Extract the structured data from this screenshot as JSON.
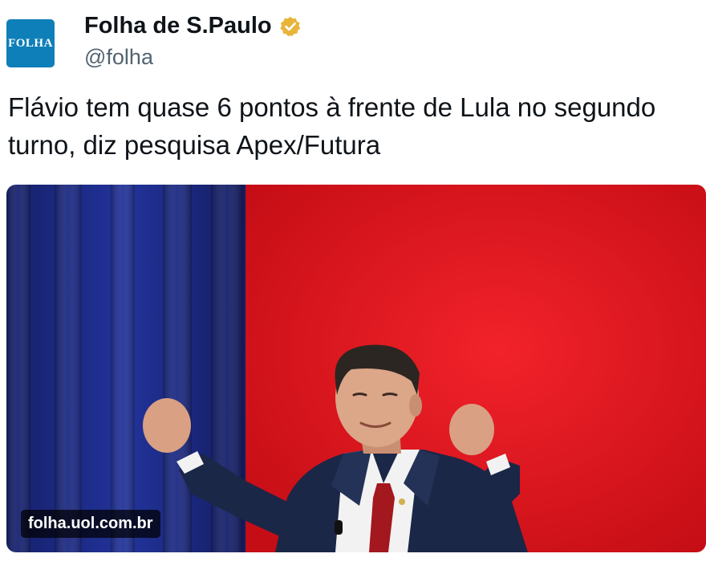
{
  "author": {
    "avatar_text": "FOLHA",
    "display_name": "Folha de S.Paulo",
    "handle": "@folha",
    "verified_icon": "gold-verified-badge-icon",
    "avatar_color": "#0e7fb8"
  },
  "tweet": {
    "text": "Flávio tem quase 6 pontos à frente de Lula no segundo turno, diz pesquisa Apex/Futura"
  },
  "media": {
    "source": "folha.uol.com.br",
    "description_icon": "photo-man-raising-fists",
    "colors": {
      "left_panel": "#1c2a78",
      "right_panel": "#e8141c"
    }
  }
}
